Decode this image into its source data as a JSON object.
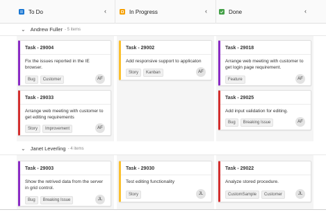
{
  "columns": [
    {
      "title": "To Do",
      "icon": "todo-icon",
      "icon_color": "#1976d2",
      "collapse": "‹"
    },
    {
      "title": "In Progress",
      "icon": "inprogress-icon",
      "icon_color": "#f59f00",
      "collapse": "‹"
    },
    {
      "title": "Done",
      "icon": "done-icon",
      "icon_color": "#43a047",
      "collapse": "‹"
    }
  ],
  "swimlanes": [
    {
      "name": "Andrew Fuller",
      "count": "- 5 items"
    },
    {
      "name": "Janet Leverling",
      "count": "- 4 items"
    }
  ],
  "lane_chevron": "⌄",
  "cards": {
    "c1": {
      "id": "Task - 29004",
      "desc": "Fix the issues reported in the IE browser.",
      "tags": [
        "Bug",
        "Customer"
      ],
      "avatar": "AF",
      "color": "#8a2bc4"
    },
    "c2": {
      "id": "Task - 29033",
      "desc": "Arrange web meeting with customer to get editing requirements",
      "tags": [
        "Story",
        "Improvement"
      ],
      "avatar": "AF",
      "color": "#d32f2f"
    },
    "c3": {
      "id": "Task - 29002",
      "desc": "Add responsive support to applicaton",
      "tags": [
        "Story",
        "Kanban"
      ],
      "avatar": "AF",
      "color": "#fbc02d"
    },
    "c4": {
      "id": "Task - 29018",
      "desc": "Arrange web meeting with customer to get login page requirement.",
      "tags": [
        "Feature"
      ],
      "avatar": "AF",
      "color": "#8a2bc4"
    },
    "c5": {
      "id": "Task - 29025",
      "desc": "Add input validation for editing.",
      "tags": [
        "Bug",
        "Breaking Issue"
      ],
      "avatar": "AF",
      "color": "#d32f2f"
    },
    "c6": {
      "id": "Task - 29003",
      "desc": "Show the retrived data from the server in grid control.",
      "tags": [
        "Bug",
        "Breaking Issue"
      ],
      "avatar": "JL",
      "color": "#8a2bc4"
    },
    "c7": {
      "id": "Task - 29030",
      "desc": "Test editing functionality",
      "tags": [
        "Story"
      ],
      "avatar": "JL",
      "color": "#fbc02d"
    },
    "c8": {
      "id": "Task - 29022",
      "desc": "Analyze stored procedure.",
      "tags": [
        "CustomSample",
        "Customer"
      ],
      "avatar": "JL",
      "color": "#d32f2f"
    }
  }
}
